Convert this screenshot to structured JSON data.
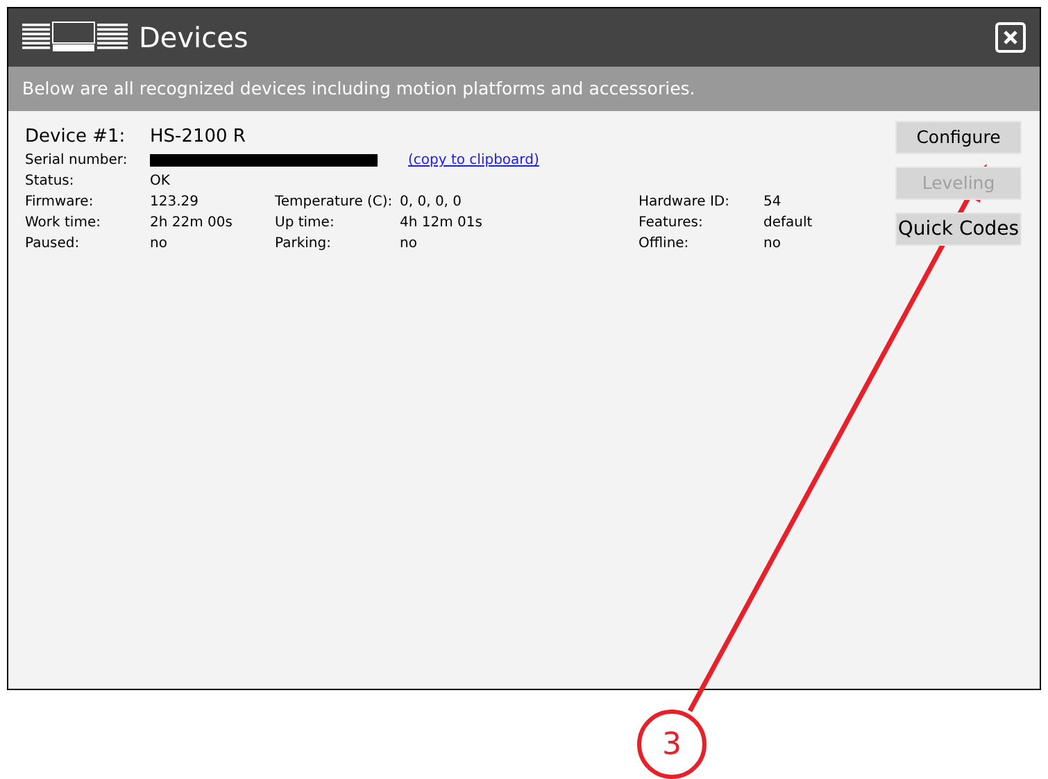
{
  "window": {
    "title": "Devices"
  },
  "subtitle": "Below are all recognized devices including motion platforms and accessories.",
  "device": {
    "label": "Device #1:",
    "name": "HS-2100 R",
    "serial_label": "Serial number:",
    "copy_link": "(copy to clipboard)",
    "status_label": "Status:",
    "status_value": "OK"
  },
  "fields": [
    [
      {
        "label": "Firmware:",
        "value": "123.29"
      },
      {
        "label": "Temperature (C):",
        "value": "0, 0, 0, 0"
      },
      {
        "label": "Hardware ID:",
        "value": "54"
      }
    ],
    [
      {
        "label": "Work time:",
        "value": "2h 22m 00s"
      },
      {
        "label": "Up time:",
        "value": "4h 12m 01s"
      },
      {
        "label": "Features:",
        "value": "default"
      }
    ],
    [
      {
        "label": "Paused:",
        "value": "no"
      },
      {
        "label": "Parking:",
        "value": "no"
      },
      {
        "label": "Offline:",
        "value": "no"
      }
    ]
  ],
  "buttons": [
    {
      "label": "Configure",
      "disabled": false,
      "large": false
    },
    {
      "label": "Leveling",
      "disabled": true,
      "large": false
    },
    {
      "label": "Quick Codes",
      "disabled": false,
      "large": true
    }
  ],
  "callout": {
    "number": "3"
  }
}
